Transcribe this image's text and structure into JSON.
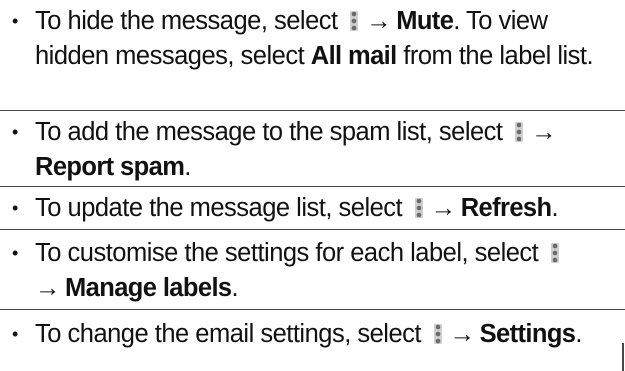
{
  "bullets": [
    {
      "segments": [
        {
          "t": "To hide the message, select ",
          "style": "normal"
        },
        {
          "icon": "menu-icon"
        },
        {
          "t": "→",
          "style": "arrow"
        },
        {
          "t": "Mute",
          "style": "bold"
        },
        {
          "t": ". To view hidden messages, select ",
          "style": "normal"
        },
        {
          "t": "All mail",
          "style": "bold"
        },
        {
          "t": " from the label list.",
          "style": "normal"
        }
      ]
    },
    {
      "segments": [
        {
          "t": "To add the message to the spam list, select ",
          "style": "normal"
        },
        {
          "icon": "menu-icon"
        },
        {
          "t": "→",
          "style": "arrow"
        },
        {
          "t": "Report spam",
          "style": "bold"
        },
        {
          "t": ".",
          "style": "normal"
        }
      ]
    },
    {
      "segments": [
        {
          "t": "To update the message list, select ",
          "style": "normal"
        },
        {
          "icon": "menu-icon"
        },
        {
          "t": "→",
          "style": "arrow"
        },
        {
          "t": "Refresh",
          "style": "bold"
        },
        {
          "t": ".",
          "style": "normal"
        }
      ]
    },
    {
      "segments": [
        {
          "t": "To customise the settings for each label, select ",
          "style": "normal"
        },
        {
          "icon": "menu-icon"
        },
        {
          "t": "→",
          "style": "arrow"
        },
        {
          "t": "Manage labels",
          "style": "bold"
        },
        {
          "t": ".",
          "style": "normal"
        }
      ]
    },
    {
      "segments": [
        {
          "t": "To change the email settings, select ",
          "style": "normal"
        },
        {
          "icon": "menu-icon"
        },
        {
          "t": "→",
          "style": "arrow"
        },
        {
          "t": "Settings",
          "style": "bold"
        },
        {
          "t": ".",
          "style": "normal"
        }
      ]
    }
  ],
  "bullet_glyph": "•",
  "colors": {
    "text": "#111111",
    "rule": "#4a4a4a",
    "icon_bg": "#cfcfcf",
    "icon_dots": "#6b6b6b"
  }
}
